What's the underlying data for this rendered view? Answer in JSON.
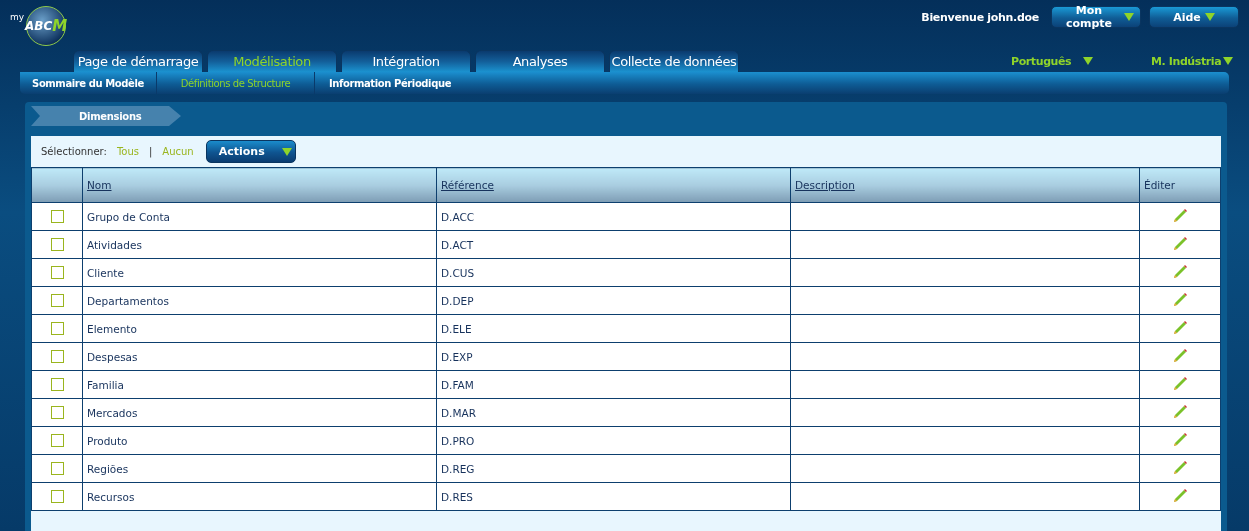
{
  "header": {
    "logo_prefix": "my",
    "logo_text": "ABC",
    "logo_accent": "M",
    "welcome": "Bienvenue john.doe",
    "menus": [
      {
        "label": "Mon compte"
      },
      {
        "label": "Aide"
      }
    ],
    "selectors": [
      {
        "label": "Português"
      },
      {
        "label": "M. Indústria"
      }
    ]
  },
  "tabs": [
    {
      "label": "Page de démarrage",
      "selected": false
    },
    {
      "label": "Modélisation",
      "selected": true
    },
    {
      "label": "Intégration",
      "selected": false
    },
    {
      "label": "Analyses",
      "selected": false
    },
    {
      "label": "Collecte de données",
      "selected": false
    }
  ],
  "subtabs": [
    {
      "label": "Sommaire du Modèle",
      "selected": false
    },
    {
      "label": "Définitions de Structure",
      "selected": true
    },
    {
      "label": "Information Périodique",
      "selected": false
    }
  ],
  "breadcrumb": "Dimensions",
  "toolbar": {
    "select_label": "Sélectionner:",
    "all": "Tous",
    "separator": "|",
    "none": "Aucun",
    "actions": "Actions"
  },
  "table": {
    "columns": [
      "Nom",
      "Référence",
      "Description",
      "Éditer"
    ],
    "rows": [
      {
        "name": "Grupo de Conta",
        "reference": "D.ACC",
        "checked": false
      },
      {
        "name": "Atividades",
        "reference": "D.ACT",
        "checked": false
      },
      {
        "name": "Cliente",
        "reference": "D.CUS",
        "checked": false
      },
      {
        "name": "Departamentos",
        "reference": "D.DEP",
        "checked": false
      },
      {
        "name": "Elemento",
        "reference": "D.ELE",
        "checked": false
      },
      {
        "name": "Despesas",
        "reference": "D.EXP",
        "checked": false
      },
      {
        "name": "Familia",
        "reference": "D.FAM",
        "checked": false
      },
      {
        "name": "Mercados",
        "reference": "D.MAR",
        "checked": false
      },
      {
        "name": "Produto",
        "reference": "D.PRO",
        "checked": false
      },
      {
        "name": "Regiões",
        "reference": "D.REG",
        "checked": false
      },
      {
        "name": "Recursos",
        "reference": "D.RES",
        "checked": false
      }
    ]
  }
}
